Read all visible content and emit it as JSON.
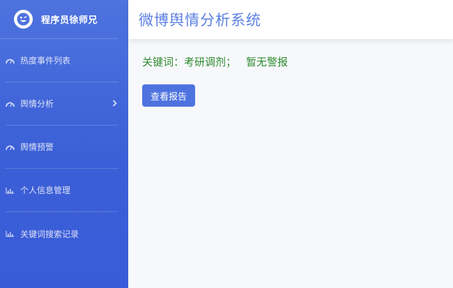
{
  "brand": {
    "name": "程序员徐师兄",
    "logo_icon": "smiley-icon"
  },
  "app": {
    "title": "微博舆情分析系统"
  },
  "sidebar": {
    "items": [
      {
        "label": "热度事件列表",
        "icon": "dashboard-gauge-icon"
      },
      {
        "label": "舆情分析",
        "icon": "dashboard-gauge-icon",
        "has_submenu": true
      },
      {
        "label": "舆情预警",
        "icon": "dashboard-gauge-icon"
      },
      {
        "label": "个人信息管理",
        "icon": "bar-chart-icon"
      },
      {
        "label": "关键词搜索记录",
        "icon": "bar-chart-icon"
      }
    ]
  },
  "main": {
    "keyword_label": "关键词：",
    "keyword_value": "考研调剂；",
    "status_text": "暂无警报",
    "report_button": "查看报告"
  },
  "colors": {
    "sidebar": "#4e73df",
    "title": "#5b7fe3",
    "keyword_text": "#2e8b2e",
    "button": "#4e73df"
  }
}
